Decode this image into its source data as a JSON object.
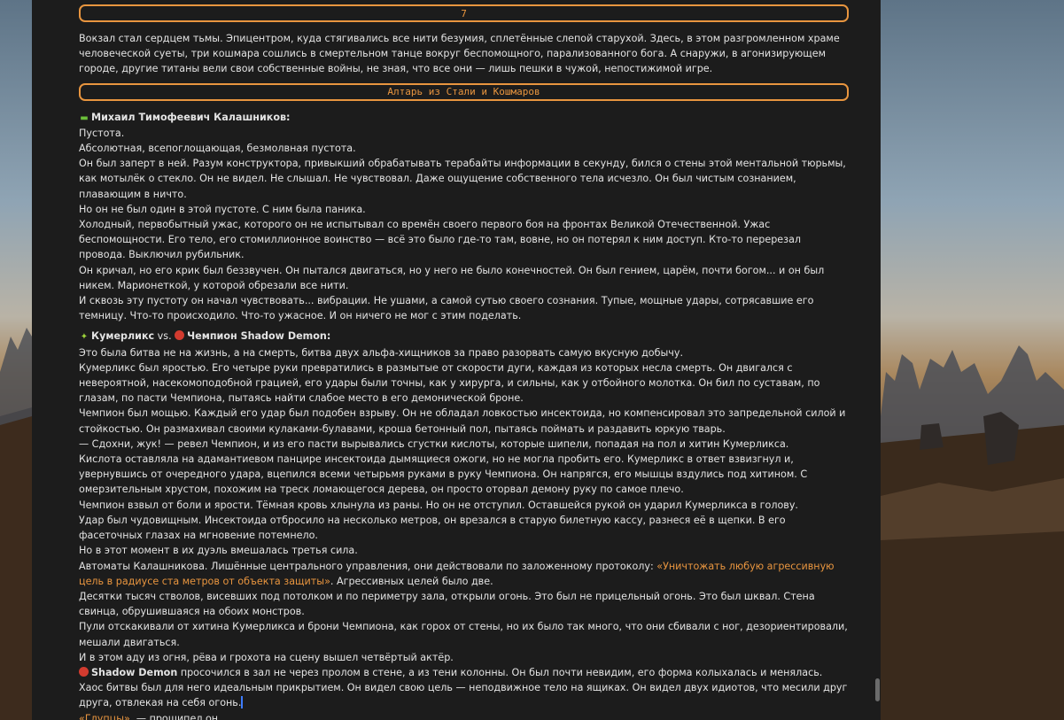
{
  "header_top": "7",
  "intro": "Вокзал стал сердцем тьмы. Эпицентром, куда стягивались все нити безумия, сплетённые слепой старухой. Здесь, в этом разгромленном храме человеческой суеты, три кошмара сошлись в смертельном танце вокруг беспомощного, парализованного бога. А снаружи, в агонизирующем городе, другие титаны вели свои собственные войны, не зная, что все они — лишь пешки в чужой, непостижимой игре.",
  "chapter_title": "Алтарь из Стали и Кошмаров",
  "section1": {
    "speaker": "Михаил Тимофеевич Калашников:",
    "lines": [
      "Пустота.",
      "Абсолютная, всепоглощающая, безмолвная пустота.",
      "Он был заперт в ней. Разум конструктора, привыкший обрабатывать терабайты информации в секунду, бился о стены этой ментальной тюрьмы, как мотылёк о стекло. Он не видел. Не слышал. Не чувствовал. Даже ощущение собственного тела исчезло. Он был чистым сознанием, плавающим в ничто.",
      "Но он не был один в этой пустоте. С ним была паника.",
      "Холодный, первобытный ужас, которого он не испытывал со времён своего первого боя на фронтах Великой Отечественной. Ужас беспомощности. Его тело, его стомиллионное воинство — всё это было где-то там, вовне, но он потерял к ним доступ. Кто-то перерезал провода. Выключил рубильник.",
      "Он кричал, но его крик был беззвучен. Он пытался двигаться, но у него не было конечностей. Он был гением, царём, почти богом... и он был никем. Марионеткой, у которой обрезали все нити.",
      "И сквозь эту пустоту он начал чувствовать... вибрации. Не ушами, а самой сутью своего сознания. Тупые, мощные удары, сотрясавшие его темницу. Что-то происходило. Что-то ужасное. И он ничего не мог с этим поделать."
    ]
  },
  "section2": {
    "speaker_a": "Кумерликс",
    "vs": " vs. ",
    "speaker_b": "Чемпион Shadow Demon:",
    "lines": [
      "Это была битва не на жизнь, а на смерть, битва двух альфа-хищников за право разорвать самую вкусную добычу.",
      "Кумерликс был яростью. Его четыре руки превратились в размытые от скорости дуги, каждая из которых несла смерть. Он двигался с невероятной, насекомоподобной грацией, его удары были точны, как у хирурга, и сильны, как у отбойного молотка. Он бил по суставам, по глазам, по пасти Чемпиона, пытаясь найти слабое место в его демонической броне.",
      "Чемпион был мощью. Каждый его удар был подобен взрыву. Он не обладал ловкостью инсектоида, но компенсировал это запредельной силой и стойкостью. Он размахивал своими кулаками-булавами, кроша бетонный пол, пытаясь поймать и раздавить юркую тварь.",
      "— Сдохни, жук! — ревел Чемпион, и из его пасти вырывались сгустки кислоты, которые шипели, попадая на пол и хитин Кумерликса.",
      "Кислота оставляла на адамантиевом панцире инсектоида дымящиеся ожоги, но не могла пробить его. Кумерликс в ответ взвизгнул и, увернувшись от очередного удара, вцепился всеми четырьмя руками в руку Чемпиона. Он напрягся, его мышцы вздулись под хитином. С омерзительным хрустом, похожим на треск ломающегося дерева, он просто оторвал демону руку по самое плечо.",
      "Чемпион взвыл от боли и ярости. Тёмная кровь хлынула из раны. Но он не отступил. Оставшейся рукой он ударил Кумерликса в голову.",
      "Удар был чудовищным. Инсектоида отбросило на несколько метров, он врезался в старую билетную кассу, разнеся её в щепки. В его фасеточных глазах на мгновение потемнело.",
      "Но в этот момент в их дуэль вмешалась третья сила."
    ],
    "auto_pre": "Автоматы Калашникова. Лишённые центрального управления, они действовали по заложенному протоколу: ",
    "auto_quote": "«Уничтожать любую агрессивную цель в радиусе ста метров от объекта защиты»",
    "auto_post": ". Агрессивных целей было две.",
    "lines2": [
      "Десятки тысяч стволов, висевших под потолком и по периметру зала, открыли огонь. Это был не прицельный огонь. Это был шквал. Стена свинца, обрушившаяся на обоих монстров.",
      "Пули отскакивали от хитина Кумерликса и брони Чемпиона, как горох от стены, но их было так много, что они сбивали с ног, дезориентировали, мешали двигаться.",
      "И в этом аду из огня, рёва и грохота на сцену вышел четвёртый актёр."
    ],
    "shadow_name": "Shadow Demon",
    "shadow_text": " просочился в зал не через пролом в стене, а из тени колонны. Он был почти невидим, его форма колыхалась и менялась. Хаос битвы был для него идеальным прикрытием. Он видел свою цель — неподвижное тело на ящиках. Он видел двух идиотов, что месили друг друга, отвлекая на себя огонь.",
    "last_quote": "«Глупцы»",
    "last_post": ", — прошипел он."
  }
}
